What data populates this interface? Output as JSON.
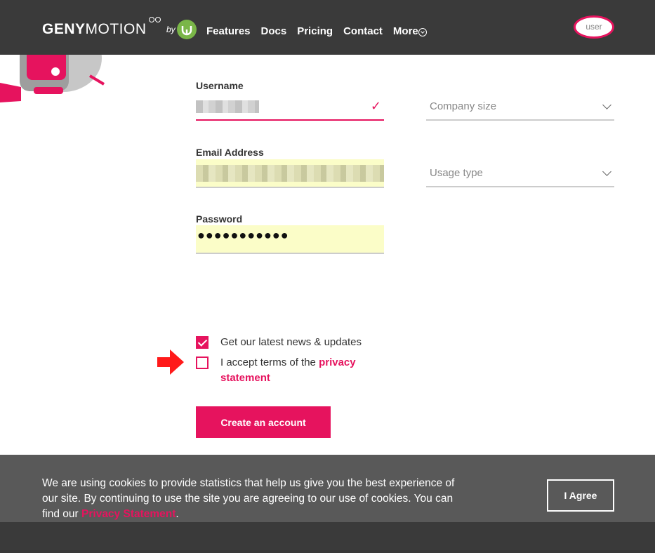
{
  "header": {
    "logo_bold": "GENY",
    "logo_light": "MOTION",
    "by": "by",
    "nav": [
      "Features",
      "Docs",
      "Pricing",
      "Contact",
      "More"
    ],
    "avatar_alt": "user"
  },
  "form": {
    "username_label": "Username",
    "email_label": "Email Address",
    "password_label": "Password",
    "password_value": "●●●●●●●●●●●",
    "company_size_placeholder": "Company size",
    "usage_type_placeholder": "Usage type",
    "newsletter_label": "Get our latest news & updates",
    "terms_prefix": "I accept terms of the ",
    "terms_link": "privacy statement",
    "newsletter_checked": true,
    "terms_checked": false,
    "submit_label": "Create an account"
  },
  "cookie": {
    "text": "We are using cookies to provide statistics that help us give you the best experience of our site. By continuing to use the site you are agreeing to our use of cookies. You can find our ",
    "link": "Privacy Statement",
    "suffix": ".",
    "button": "I Agree"
  },
  "colors": {
    "accent": "#e6135e",
    "header_bg": "#3a3a3a",
    "banner_bg": "#595959",
    "autofill": "#fbfdc8"
  }
}
